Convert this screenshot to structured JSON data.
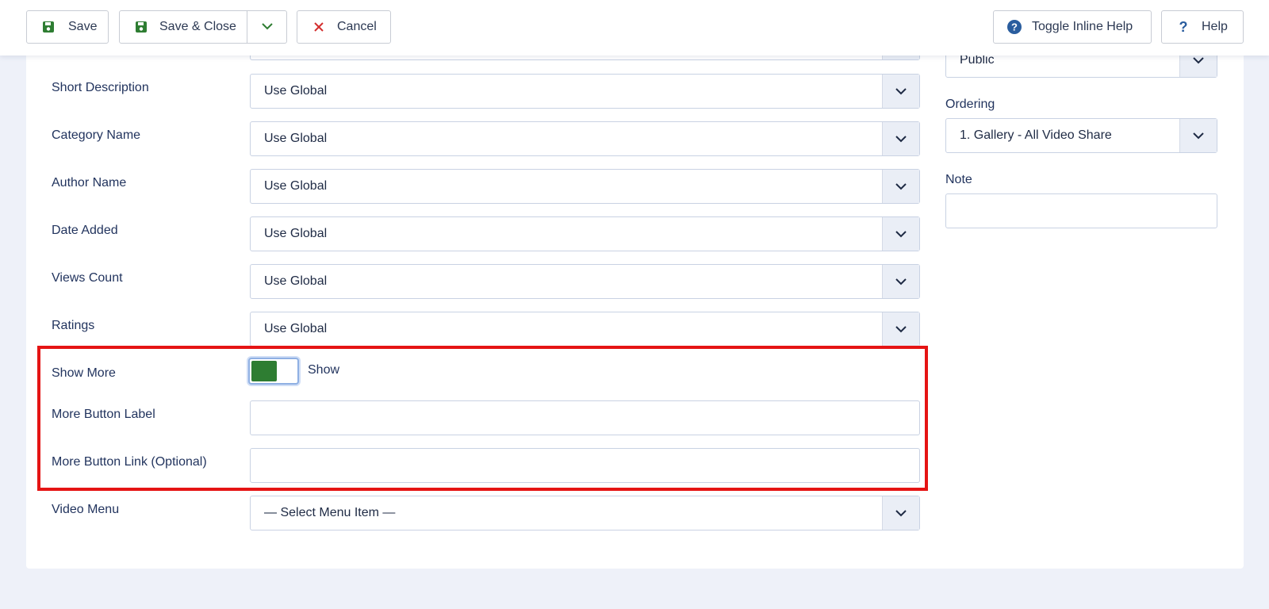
{
  "toolbar": {
    "save_label": "Save",
    "save_close_label": "Save & Close",
    "cancel_label": "Cancel",
    "toggle_help_label": "Toggle Inline Help",
    "help_label": "Help"
  },
  "fields": [
    {
      "label": "Short Description",
      "value": "Use Global"
    },
    {
      "label": "Category Name",
      "value": "Use Global"
    },
    {
      "label": "Author Name",
      "value": "Use Global"
    },
    {
      "label": "Date Added",
      "value": "Use Global"
    },
    {
      "label": "Views Count",
      "value": "Use Global"
    },
    {
      "label": "Ratings",
      "value": "Use Global"
    }
  ],
  "show_more": {
    "label": "Show More",
    "state_text": "Show",
    "enabled": true
  },
  "more_button_label": {
    "label": "More Button Label",
    "value": ""
  },
  "more_button_link": {
    "label": "More Button Link (Optional)",
    "value": ""
  },
  "video_menu": {
    "label": "Video Menu",
    "value": "— Select Menu Item —"
  },
  "sidebar": {
    "access_value": "Public",
    "ordering_label": "Ordering",
    "ordering_value": "1. Gallery - All Video Share",
    "note_label": "Note",
    "note_value": ""
  },
  "colors": {
    "highlight": "#e51414",
    "toggle_on": "#2e7d32",
    "save_icon": "#2e7d32",
    "cancel_icon": "#d32f2f",
    "help_icon": "#2a5d9e"
  }
}
